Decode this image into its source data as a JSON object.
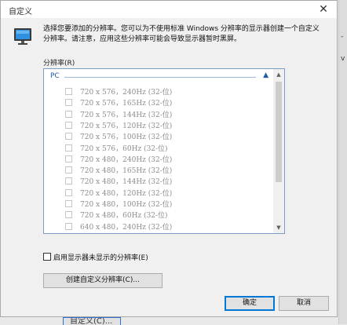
{
  "dialog": {
    "title": "自定义",
    "close_glyph": "✕"
  },
  "description": "选择您要添加的分辨率。您可以为不使用标准 Windows 分辨率的显示器创建一个自定义分辨率。请注意，应用这些分辨率可能会导致显示器暂时黑屏。",
  "resolution_label": "分辨率(R)",
  "list": {
    "group_name": "PC",
    "items": [
      "720 x 576，240Hz (32-位)",
      "720 x 576，165Hz (32-位)",
      "720 x 576，144Hz (32-位)",
      "720 x 576，120Hz (32-位)",
      "720 x 576，100Hz (32-位)",
      "720 x 576，60Hz (32-位)",
      "720 x 480，240Hz (32-位)",
      "720 x 480，165Hz (32-位)",
      "720 x 480，144Hz (32-位)",
      "720 x 480，120Hz (32-位)",
      "720 x 480，100Hz (32-位)",
      "720 x 480，60Hz (32-位)",
      "640 x 480，240Hz (32-位)"
    ]
  },
  "checkbox_show_all": "启用显示器未显示的分辨率(E)",
  "buttons": {
    "create_custom": "创建自定义分辨率(C)...",
    "ok": "确定",
    "cancel": "取消"
  },
  "background": {
    "bottom_peek_text": "自定义(C)...",
    "right_peek_glyphs": [
      "-",
      "v"
    ]
  },
  "colors": {
    "accent": "#0078d7",
    "group_header": "#1f5ca8"
  }
}
